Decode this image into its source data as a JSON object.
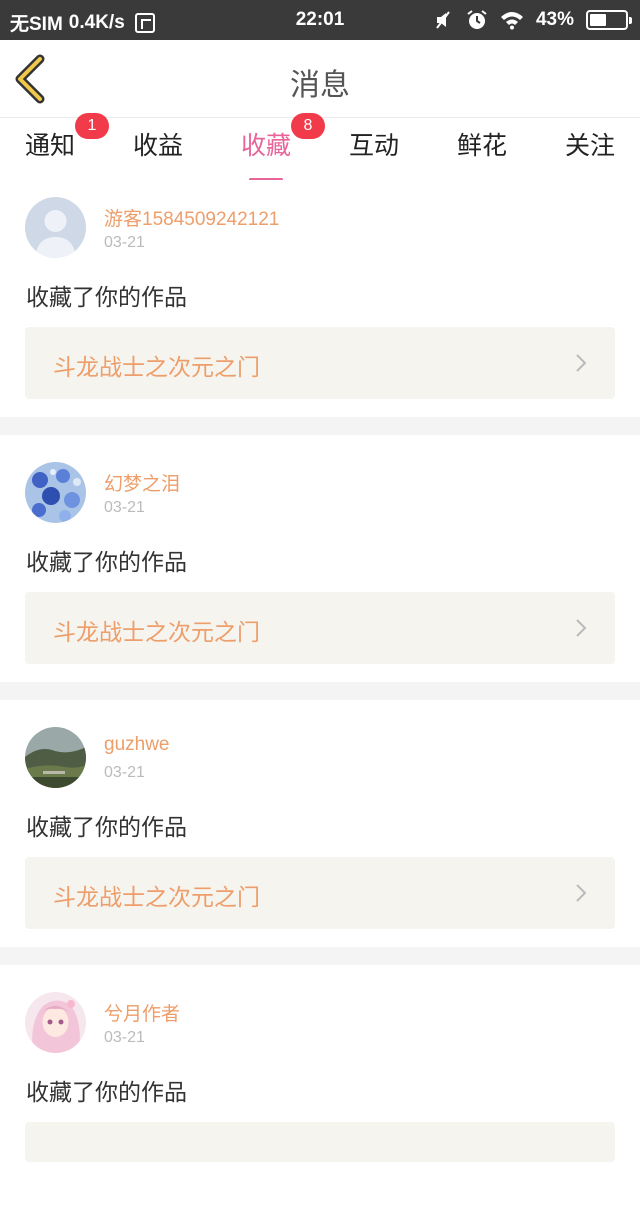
{
  "status_bar": {
    "carrier": "无SIM",
    "speed": "0.4K/s",
    "time": "22:01",
    "battery": "43%"
  },
  "header": {
    "title": "消息"
  },
  "tabs": [
    {
      "label": "通知",
      "badge": "1"
    },
    {
      "label": "收益",
      "badge": ""
    },
    {
      "label": "收藏",
      "badge": "8"
    },
    {
      "label": "互动",
      "badge": ""
    },
    {
      "label": "鲜花",
      "badge": ""
    },
    {
      "label": "关注",
      "badge": ""
    }
  ],
  "active_tab": "收藏",
  "colors": {
    "accent": "#e8659a",
    "badge": "#f23b4a",
    "username": "#ee9e6a",
    "work_bg": "#f5f4ef"
  },
  "feed": [
    {
      "username": "游客1584509242121",
      "date": "03-21",
      "action": "收藏了你的作品",
      "work_title": "斗龙战士之次元之门",
      "avatar": "default-user-avatar"
    },
    {
      "username": "幻梦之泪",
      "date": "03-21",
      "action": "收藏了你的作品",
      "work_title": "斗龙战士之次元之门",
      "avatar": "blue-flowers-avatar"
    },
    {
      "username": "guzhwe",
      "date": "03-21",
      "action": "收藏了你的作品",
      "work_title": "斗龙战士之次元之门",
      "avatar": "landscape-avatar"
    },
    {
      "username": "兮月作者",
      "date": "03-21",
      "action": "收藏了你的作品",
      "work_title": "",
      "avatar": "anime-girl-avatar"
    }
  ]
}
